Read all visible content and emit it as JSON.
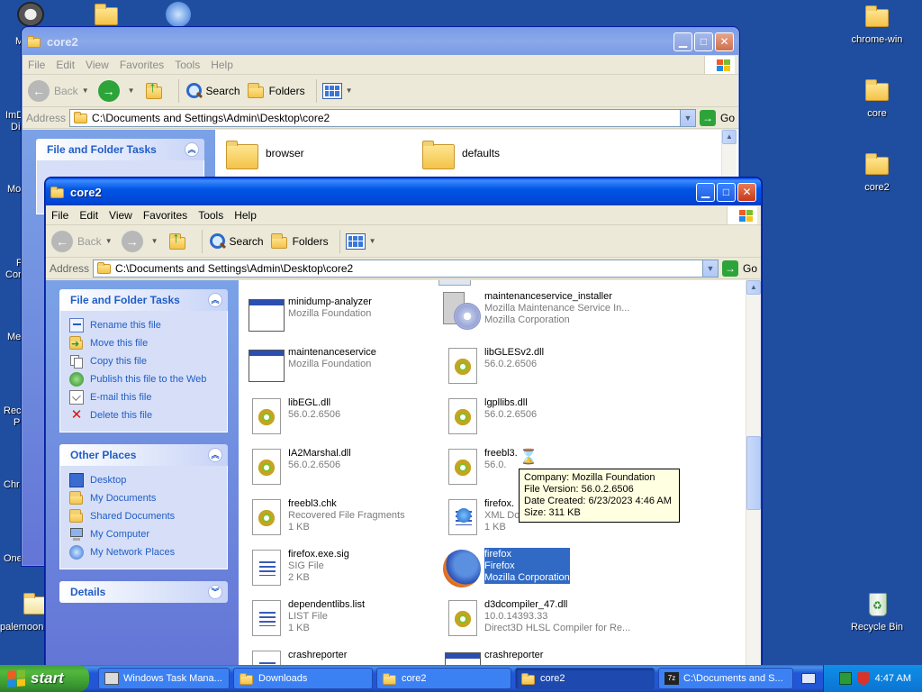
{
  "desktop": {
    "left_labels": [
      "M",
      "ImD",
      "Di",
      "Mo",
      "F",
      "Con",
      "Me",
      "Rec",
      "P",
      "Chr",
      "One",
      "palemoon-"
    ],
    "right_icons": [
      {
        "label": "chrome-win"
      },
      {
        "label": "core"
      },
      {
        "label": "core2"
      },
      {
        "label": "Recycle Bin"
      }
    ]
  },
  "back_window": {
    "title": "core2",
    "menu": [
      "File",
      "Edit",
      "View",
      "Favorites",
      "Tools",
      "Help"
    ],
    "toolbar": {
      "back": "Back",
      "search": "Search",
      "folders": "Folders"
    },
    "address_label": "Address",
    "address": "C:\\Documents and Settings\\Admin\\Desktop\\core2",
    "go": "Go",
    "panel_title": "File and Folder Tasks",
    "folders": [
      "browser",
      "defaults"
    ]
  },
  "front_window": {
    "title": "core2",
    "menu": [
      "File",
      "Edit",
      "View",
      "Favorites",
      "Tools",
      "Help"
    ],
    "toolbar": {
      "back": "Back",
      "search": "Search",
      "folders": "Folders"
    },
    "address_label": "Address",
    "address": "C:\\Documents and Settings\\Admin\\Desktop\\core2",
    "go": "Go",
    "panels": {
      "tasks_title": "File and Folder Tasks",
      "tasks": [
        "Rename this file",
        "Move this file",
        "Copy this file",
        "Publish this file to the Web",
        "E-mail this file",
        "Delete this file"
      ],
      "places_title": "Other Places",
      "places": [
        "Desktop",
        "My Documents",
        "Shared Documents",
        "My Computer",
        "My Network Places"
      ],
      "details_title": "Details"
    },
    "files": [
      {
        "name": "minidump-analyzer",
        "l2": "Mozilla Foundation",
        "l3": "",
        "icon": "app"
      },
      {
        "name": "maintenanceservice_installer",
        "l2": "Mozilla Maintenance Service In...",
        "l3": "Mozilla Corporation",
        "icon": "setup"
      },
      {
        "name": "maintenanceservice",
        "l2": "Mozilla Foundation",
        "l3": "",
        "icon": "app"
      },
      {
        "name": "libGLESv2.dll",
        "l2": "56.0.2.6506",
        "l3": "",
        "icon": "dll"
      },
      {
        "name": "libEGL.dll",
        "l2": "56.0.2.6506",
        "l3": "",
        "icon": "dll"
      },
      {
        "name": "lgpllibs.dll",
        "l2": "56.0.2.6506",
        "l3": "",
        "icon": "dll"
      },
      {
        "name": "IA2Marshal.dll",
        "l2": "56.0.2.6506",
        "l3": "",
        "icon": "dll"
      },
      {
        "name": "freebl3.dll",
        "l2": "56.0.2.6506",
        "l3": "",
        "icon": "dll"
      },
      {
        "name": "freebl3.chk",
        "l2": "Recovered File Fragments",
        "l3": "1 KB",
        "icon": "dll"
      },
      {
        "name": "firefox.VisualElementsManifest.xml",
        "l2": "XML Document",
        "l3": "1 KB",
        "icon": "xml"
      },
      {
        "name": "firefox.exe.sig",
        "l2": "SIG File",
        "l3": "2 KB",
        "icon": "doc"
      },
      {
        "name": "firefox",
        "l2": "Firefox",
        "l3": "Mozilla Corporation",
        "icon": "ff"
      },
      {
        "name": "dependentlibs.list",
        "l2": "LIST File",
        "l3": "1 KB",
        "icon": "doc"
      },
      {
        "name": "d3dcompiler_47.dll",
        "l2": "10.0.14393.33",
        "l3": "Direct3D HLSL Compiler for Re...",
        "icon": "dll"
      },
      {
        "name": "crashreporter",
        "l2": "",
        "l3": "",
        "icon": "doc"
      },
      {
        "name": "crashreporter",
        "l2": "",
        "l3": "",
        "icon": "app"
      }
    ],
    "visible_names": {
      "freebl3_trunc": "freebl3.",
      "freebl3_ver_trunc": "56.0.",
      "xml_trunc": "firefox.",
      "xml_type_trunc": "XML Doc"
    },
    "tooltip": [
      "Company: Mozilla Foundation",
      "File Version: 56.0.2.6506",
      "Date Created: 6/23/2023 4:46 AM",
      "Size: 311 KB"
    ]
  },
  "taskbar": {
    "start": "start",
    "buttons": [
      {
        "label": "Windows Task Mana..."
      },
      {
        "label": "Downloads"
      },
      {
        "label": "core2"
      },
      {
        "label": "core2"
      },
      {
        "label": "C:\\Documents and S..."
      }
    ],
    "clock": "4:47 AM"
  }
}
